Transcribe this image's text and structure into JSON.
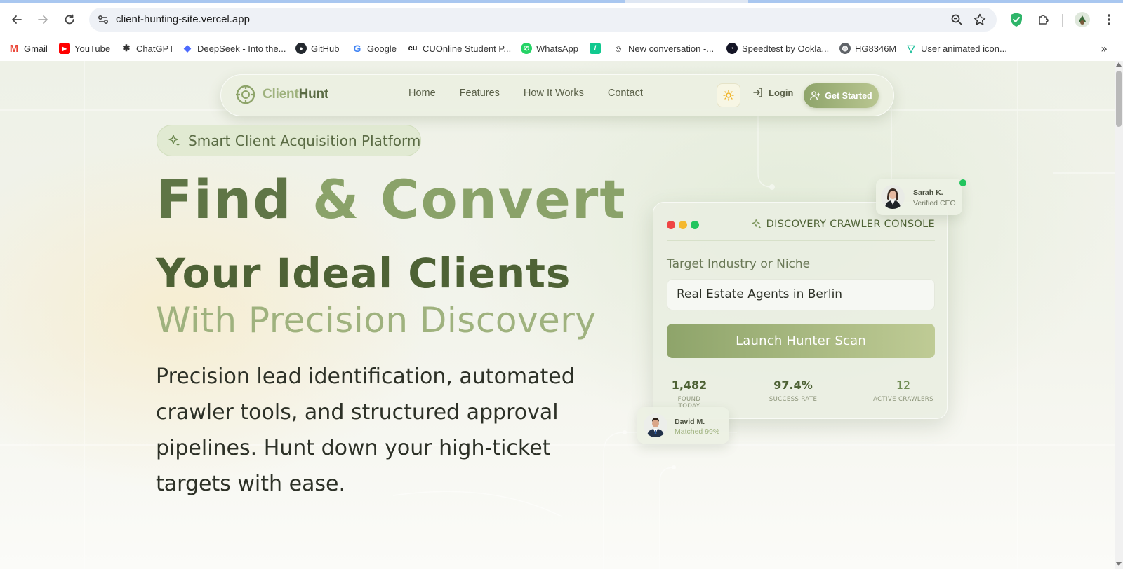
{
  "browser": {
    "url": "client-hunting-site.vercel.app",
    "bookmarks": [
      {
        "label": "Gmail",
        "icon": "gmail-icon",
        "color": "#ea4335"
      },
      {
        "label": "YouTube",
        "icon": "youtube-icon",
        "color": "#ff0000"
      },
      {
        "label": "ChatGPT",
        "icon": "chatgpt-icon",
        "color": "#333333"
      },
      {
        "label": "DeepSeek - Into the...",
        "icon": "deepseek-icon",
        "color": "#4d6bfe"
      },
      {
        "label": "GitHub",
        "icon": "github-icon",
        "color": "#24292f"
      },
      {
        "label": "Google",
        "icon": "google-icon",
        "color": "#4285f4"
      },
      {
        "label": "CUOnline Student P...",
        "icon": "cuonline-icon",
        "color": "#1a1a1a"
      },
      {
        "label": "WhatsApp",
        "icon": "whatsapp-icon",
        "color": "#25d366"
      },
      {
        "label": "",
        "icon": "green-app-icon",
        "color": "#10c98f"
      },
      {
        "label": "New conversation -...",
        "icon": "copilot-icon",
        "color": "#333333"
      },
      {
        "label": "Speedtest by Ookla...",
        "icon": "speedtest-icon",
        "color": "#141526"
      },
      {
        "label": "HG8346M",
        "icon": "globe-icon",
        "color": "#5f6368"
      },
      {
        "label": "User animated icon...",
        "icon": "vuetify-icon",
        "color": "#1cbf9a"
      }
    ]
  },
  "site": {
    "logo": {
      "part1": "Client",
      "part2": "Hunt"
    },
    "nav": [
      "Home",
      "Features",
      "How It Works",
      "Contact"
    ],
    "login": "Login",
    "cta": "Get Started"
  },
  "hero": {
    "badge": "Smart Client Acquisition Platform",
    "title_line1_a": "Find",
    "title_line1_amp": "&",
    "title_line1_b": "Convert",
    "title_line2": "Your Ideal Clients",
    "title_line3": "With Precision Discovery",
    "description": "Precision lead identification, automated crawler tools, and structured approval pipelines. Hunt down your high-ticket targets with ease."
  },
  "console": {
    "title": "DISCOVERY CRAWLER CONSOLE",
    "field_label": "Target Industry or Niche",
    "field_value": "Real Estate Agents in Berlin",
    "button": "Launch Hunter Scan",
    "stats": [
      {
        "value": "1,482",
        "label": "FOUND TODAY"
      },
      {
        "value": "97.4%",
        "label": "SUCCESS RATE"
      },
      {
        "value": "12",
        "label": "ACTIVE CRAWLERS"
      }
    ]
  },
  "chips": {
    "sarah": {
      "name": "Sarah K.",
      "sub": "Verified CEO"
    },
    "david": {
      "name": "David M.",
      "sub": "Matched 99%"
    }
  },
  "colors": {
    "brand_dark": "#4e6235",
    "brand_mid": "#8aa269",
    "brand_light": "#9fb27e",
    "online": "#22c55e",
    "dot_red": "#ef4444",
    "dot_yellow": "#f5b82e",
    "dot_green": "#22c55e"
  }
}
